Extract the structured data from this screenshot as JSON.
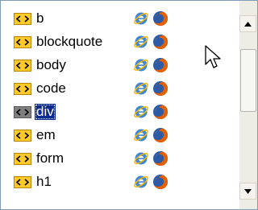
{
  "items": [
    {
      "label": "b",
      "selected": false
    },
    {
      "label": "blockquote",
      "selected": false
    },
    {
      "label": "body",
      "selected": false
    },
    {
      "label": "code",
      "selected": false
    },
    {
      "label": "div",
      "selected": true
    },
    {
      "label": "em",
      "selected": false
    },
    {
      "label": "form",
      "selected": false
    },
    {
      "label": "h1",
      "selected": false
    }
  ],
  "icons": {
    "row_icon": "html-tag-icon",
    "browser_1": "internet-explorer-icon",
    "browser_2": "firefox-icon",
    "scroll_up": "arrow-up-icon",
    "scroll_down": "arrow-down-icon",
    "pointer": "mouse-cursor-icon"
  },
  "colors": {
    "tag_icon": "#ffc929",
    "selection": "#0a2a8f",
    "border": "#7f9db9"
  }
}
